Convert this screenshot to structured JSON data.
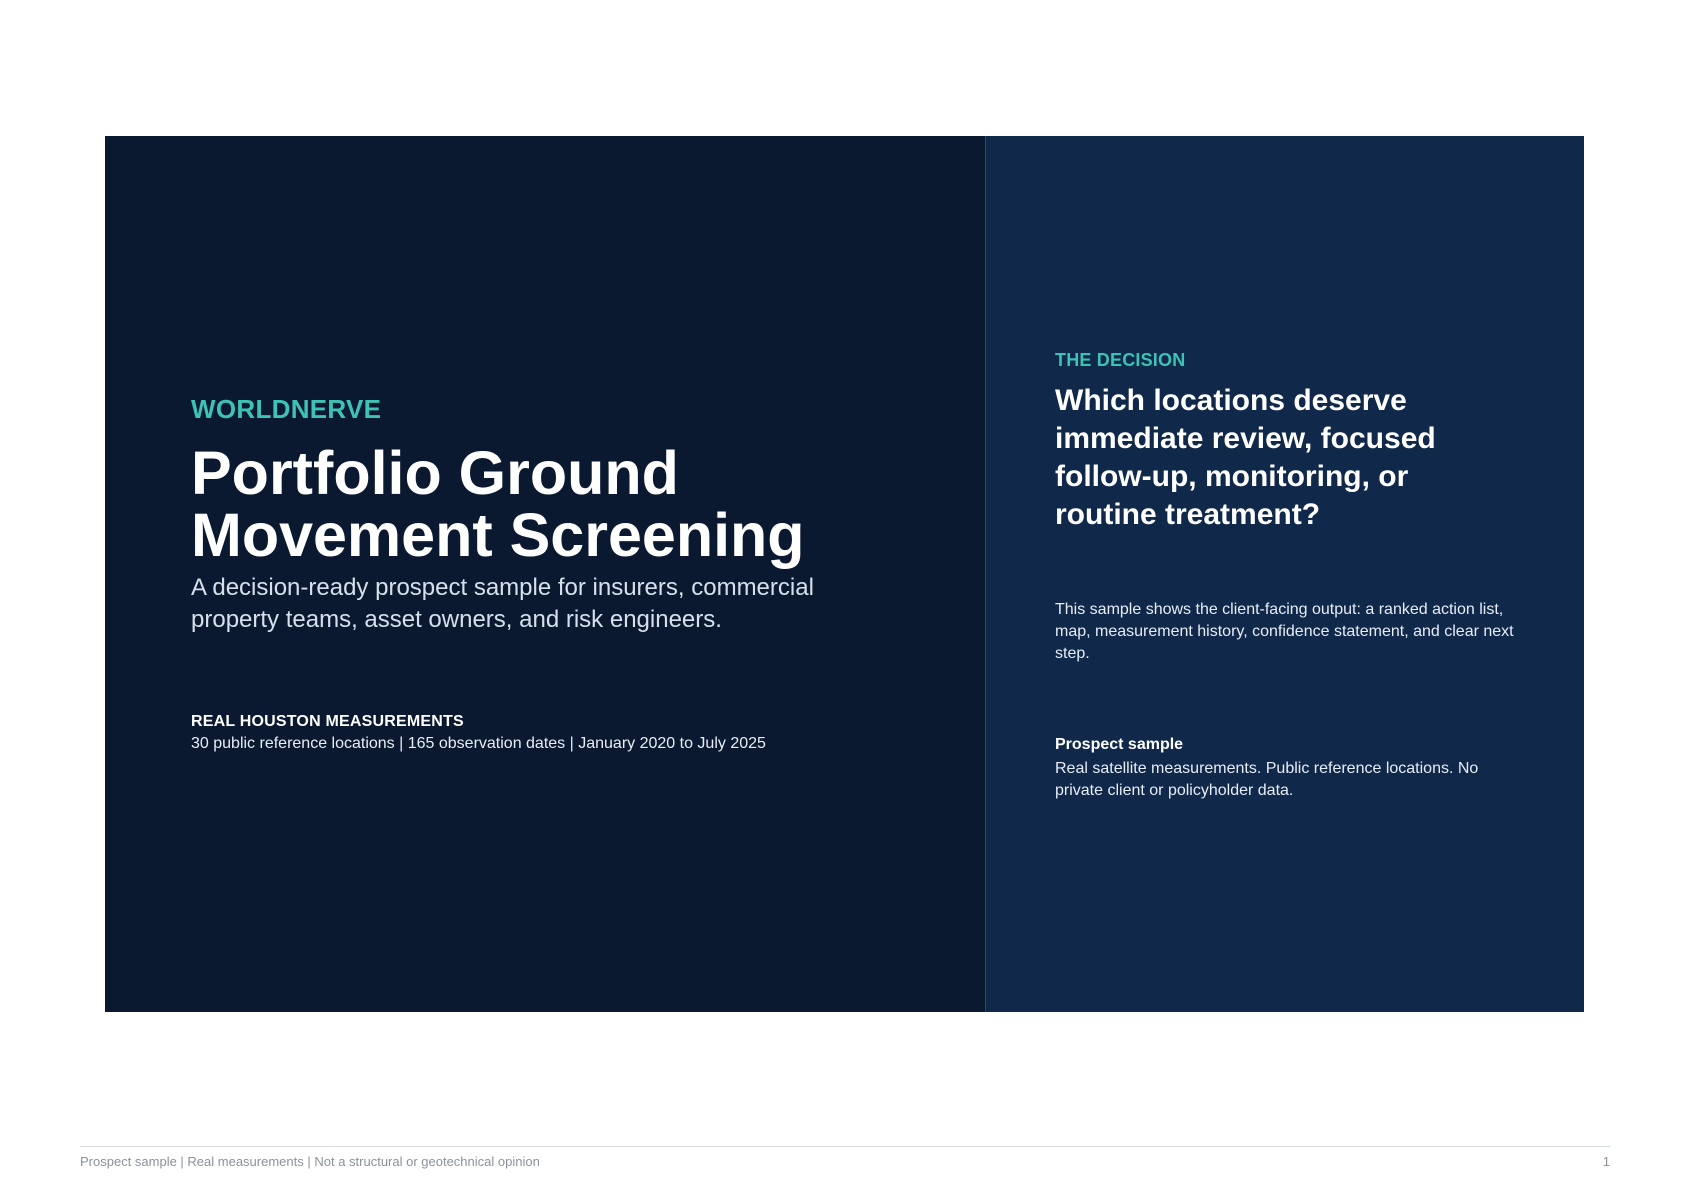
{
  "cover": {
    "brand": "WORLDNERVE",
    "title": "Portfolio Ground Movement Screening",
    "subtitle": "A decision-ready prospect sample for insurers, commercial property teams, asset owners, and risk engineers.",
    "measurements": {
      "heading": "REAL HOUSTON MEASUREMENTS",
      "detail": "30 public reference locations | 165 observation dates | January 2020 to July 2025"
    }
  },
  "decision": {
    "label": "THE DECISION",
    "question": "Which locations deserve immediate review, focused follow-up, monitoring, or routine treatment?",
    "description": "This sample shows the client-facing output: a ranked action list, map, measurement history, confidence statement, and clear next step.",
    "sample": {
      "heading": "Prospect sample",
      "description": "Real satellite measurements. Public reference locations. No private client or policyholder data."
    }
  },
  "footer": {
    "text": "Prospect sample | Real measurements | Not a structural or geotechnical opinion",
    "page_number": "1"
  },
  "colors": {
    "left_panel": "#0b1930",
    "right_panel": "#10284a",
    "accent": "#3cc3b6"
  }
}
